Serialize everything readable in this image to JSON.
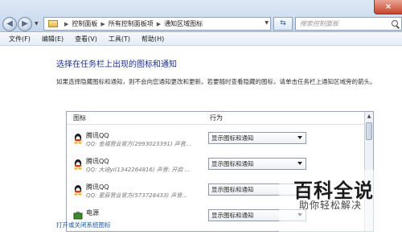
{
  "window": {
    "close_glyph": "×"
  },
  "nav": {
    "back_icon": "arrow-left-icon",
    "forward_icon": "arrow-right-icon"
  },
  "breadcrumb": [
    "控制面板",
    "所有控制面板项",
    "通知区域图标"
  ],
  "search": {
    "placeholder": "搜索控制面板"
  },
  "menu": [
    "文件(F)",
    "编辑(E)",
    "查看(V)",
    "工具(T)",
    "帮助(H)"
  ],
  "main": {
    "title": "选择在任务栏上出现的图标和通知",
    "description": "如果选择隐藏图标和通知，则不会向您通知更改和更新。若要随时查看隐藏的图标，请单击任务栏上通知区域旁的箭头。",
    "columns": {
      "icon": "图标",
      "behavior": "行为"
    },
    "rows": [
      {
        "name": "腾讯QQ",
        "detail": "QQ: 金福营业官方(2993023391)  声音...",
        "behavior": "显示图标和通知"
      },
      {
        "name": "腾讯QQ",
        "detail": "QQ: 大迪yi(1342264816)  声音: 开启 ...",
        "behavior": "显示图标和通知"
      },
      {
        "name": "腾讯QQ",
        "detail": "QQ: 星辰营业官方(573728433)  声音...",
        "behavior": "显示图标和通知"
      },
      {
        "name": "电源",
        "detail": "",
        "behavior": "显示图标和通知"
      }
    ],
    "footer_link": "打开或关闭系统图标"
  },
  "watermark": {
    "title": "百科全说",
    "subtitle": "助你轻松解决"
  },
  "colors": {
    "heading": "#1e3287",
    "link": "#1a5aa8",
    "qq_body": "#1a1a1a",
    "qq_scarf": "#e23a1c",
    "qq_feet": "#f2b21a"
  }
}
